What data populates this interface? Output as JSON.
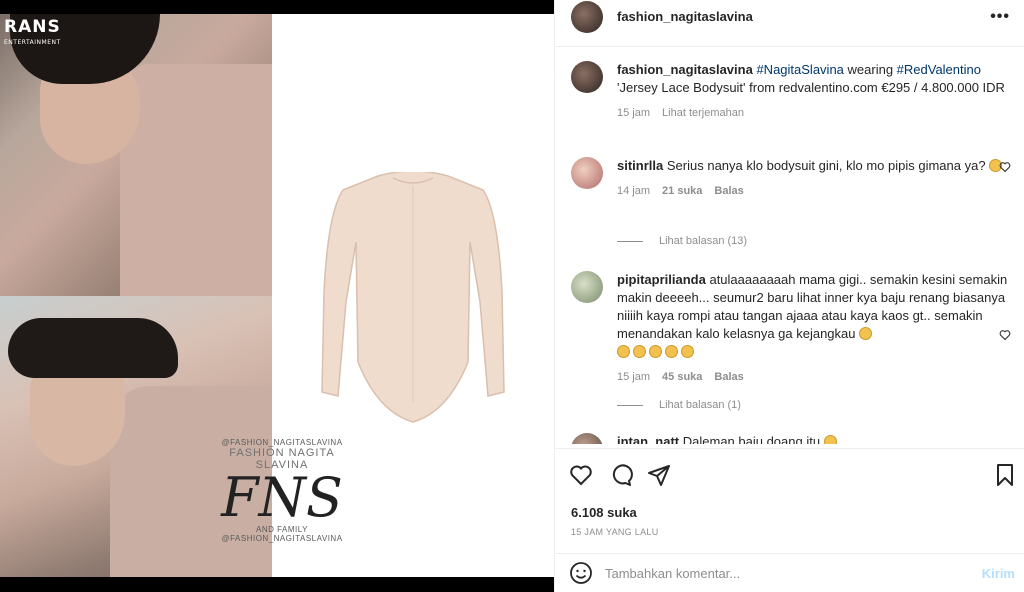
{
  "media": {
    "logo_text": "RANS",
    "logo_sub": "ENTERTAINMENT",
    "watermark_small_1": "@FASHION_NAGITASLAVINA",
    "watermark_title": "FASHION NAGITA SLAVINA",
    "watermark_big": "FNS",
    "watermark_family": "AND FAMILY",
    "watermark_small_2": "@FASHION_NAGITASLAVINA"
  },
  "header": {
    "username": "fashion_nagitaslavina",
    "more_label": "•••"
  },
  "caption": {
    "username": "fashion_nagitaslavina",
    "tag1": "#NagitaSlavina",
    "text1": " wearing ",
    "tag2": "#RedValentino",
    "text2": " 'Jersey Lace Bodysuit' from redvalentino.com €295 / 4.800.000 IDR",
    "time": "15 jam",
    "translate": "Lihat terjemahan"
  },
  "comments": [
    {
      "username": "sitinrlla",
      "text": "Serius nanya klo bodysuit gini, klo mo pipis gimana ya?",
      "time": "14 jam",
      "likes": "21 suka",
      "reply": "Balas",
      "view_replies": "Lihat balasan (13)"
    },
    {
      "username": "pipitaprilianda",
      "text": "atulaaaaaaaah mama gigi.. semakin kesini semakin makin deeeeh... seumur2 baru lihat inner kya baju renang biasanya niiiih kaya rompi atau tangan ajaaa atau kaya kaos gt.. semakin menandakan kalo kelasnya ga kejangkau",
      "time": "15 jam",
      "likes": "45 suka",
      "reply": "Balas",
      "view_replies": "Lihat balasan (1)"
    },
    {
      "username": "intan_natt",
      "text": "Daleman baju doang itu"
    }
  ],
  "footer": {
    "likes": "6.108 suka",
    "time": "15 JAM YANG LALU",
    "comment_placeholder": "Tambahkan komentar...",
    "post_label": "Kirim"
  },
  "colors": {
    "link": "#00376b",
    "muted": "#8e8e8e",
    "post_disabled": "#b2dffc"
  }
}
